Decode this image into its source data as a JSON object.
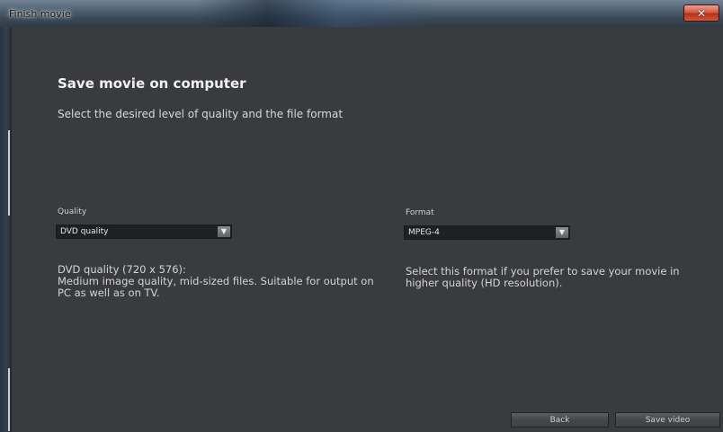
{
  "window": {
    "title": "Finish movie"
  },
  "page": {
    "heading": "Save movie on computer",
    "subheading": "Select the desired level of quality and the file format"
  },
  "quality": {
    "label": "Quality",
    "selected": "DVD quality",
    "description": "DVD quality (720 x 576):\nMedium image quality, mid-sized files. Suitable for output on\nPC as well as on TV."
  },
  "format": {
    "label": "Format",
    "selected": "MPEG-4",
    "description": "Select this format if you prefer to save your movie in\nhigher quality (HD resolution)."
  },
  "buttons": {
    "back": "Back",
    "save": "Save video"
  },
  "icons": {
    "close": "✕",
    "dropdown": "▼"
  }
}
